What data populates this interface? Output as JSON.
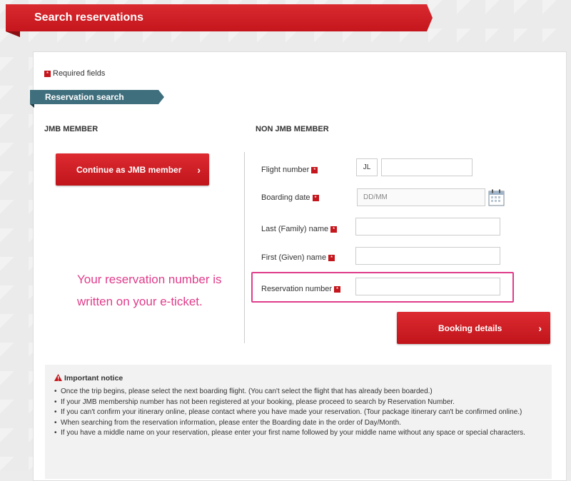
{
  "header": {
    "title": "Search reservations"
  },
  "required_note": "Required fields",
  "required_marker": "*",
  "tab": {
    "label": "Reservation search"
  },
  "columns": {
    "jmb": "JMB MEMBER",
    "non_jmb": "NON JMB MEMBER"
  },
  "jmb_button": {
    "label": "Continue as JMB member",
    "chevron": "›"
  },
  "fields": {
    "flight_number": {
      "label": "Flight number",
      "prefix": "JL",
      "value": ""
    },
    "boarding_date": {
      "label": "Boarding date",
      "placeholder": "DD/MM",
      "value": ""
    },
    "last_name": {
      "label": "Last (Family) name",
      "value": ""
    },
    "first_name": {
      "label": "First (Given) name",
      "value": ""
    },
    "reservation_number": {
      "label": "Reservation number",
      "value": ""
    }
  },
  "booking_button": {
    "label": "Booking details",
    "chevron": "›"
  },
  "annotation": "Your reservation number is written on your e-ticket.",
  "notice": {
    "title": "Important notice",
    "items": [
      "Once the trip begins, please select the next boarding flight. (You can't select the flight that has already been boarded.)",
      "If your JMB membership number has not been registered at your booking, please proceed to search by Reservation Number.",
      "If you can't confirm your itinerary online, please contact where you have made your reservation. (Tour package itinerary can't be confirmed online.)",
      "When searching from the reservation information, please enter the Boarding date in the order of Day/Month.",
      "If you have a middle name on your reservation, please enter your first name followed by your middle name without any space or special characters."
    ]
  },
  "colors": {
    "brand_red": "#c4161c",
    "tab_teal": "#3f6f7d",
    "annotation_pink": "#e03c8a"
  }
}
